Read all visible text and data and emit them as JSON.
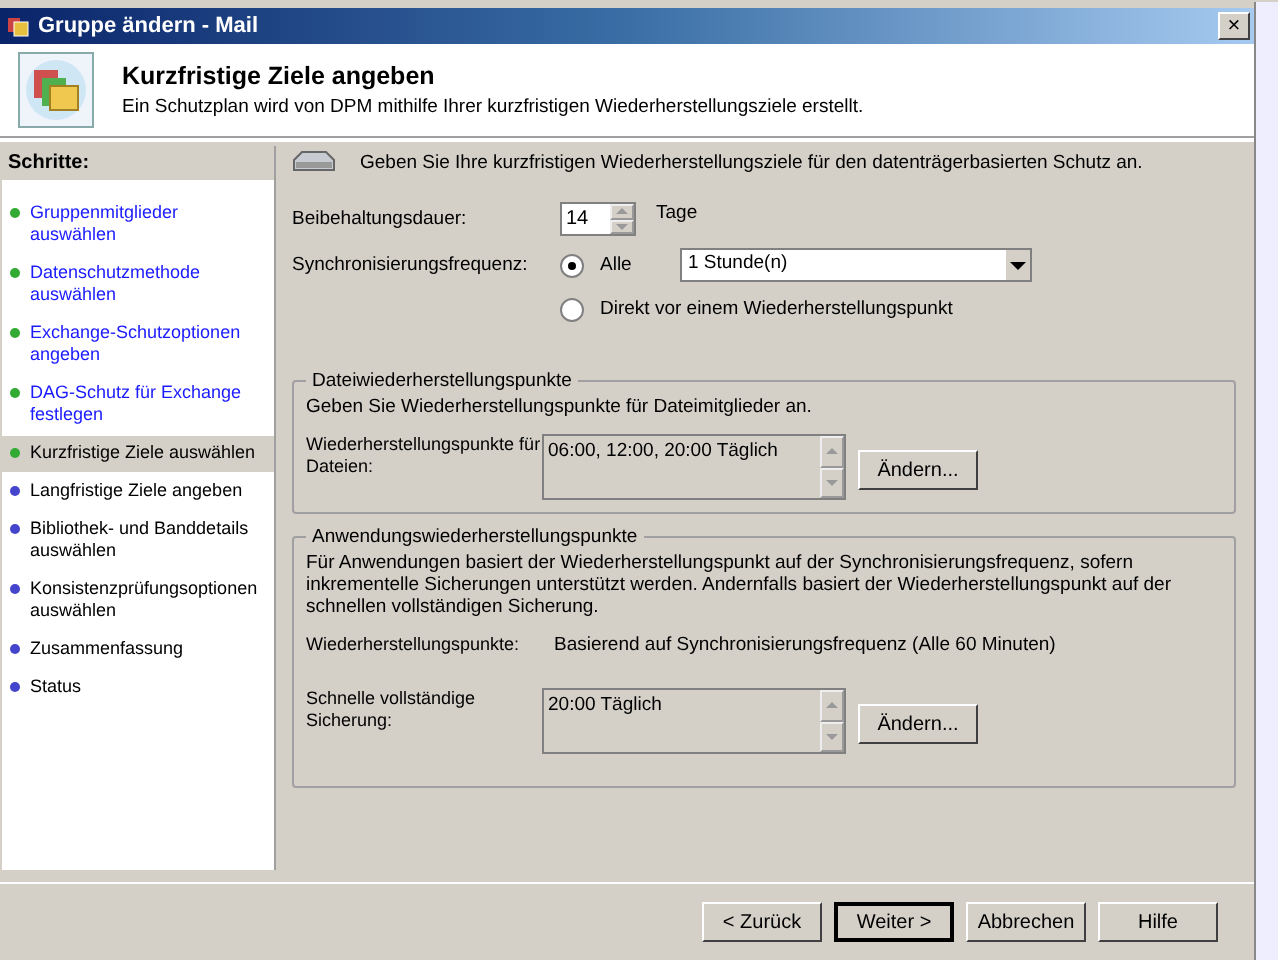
{
  "window": {
    "title": "Gruppe ändern - Mail",
    "close": "×"
  },
  "header": {
    "title": "Kurzfristige Ziele angeben",
    "subtitle": "Ein Schutzplan wird von DPM mithilfe Ihrer kurzfristigen Wiederherstellungsziele erstellt."
  },
  "sidebar": {
    "title": "Schritte:",
    "items": [
      {
        "label": "Gruppenmitglieder auswählen",
        "done": true,
        "selected": false
      },
      {
        "label": "Datenschutzmethode auswählen",
        "done": true,
        "selected": false
      },
      {
        "label": "Exchange-Schutzoptionen angeben",
        "done": true,
        "selected": false
      },
      {
        "label": "DAG-Schutz für Exchange festlegen",
        "done": true,
        "selected": false
      },
      {
        "label": "Kurzfristige Ziele auswählen",
        "done": true,
        "selected": true
      },
      {
        "label": "Langfristige Ziele angeben",
        "done": false,
        "selected": false
      },
      {
        "label": "Bibliothek- und Banddetails auswählen",
        "done": false,
        "selected": false
      },
      {
        "label": "Konsistenzprüfungsoptionen auswählen",
        "done": false,
        "selected": false
      },
      {
        "label": "Zusammenfassung",
        "done": false,
        "selected": false
      },
      {
        "label": "Status",
        "done": false,
        "selected": false
      }
    ]
  },
  "intro": "Geben Sie Ihre kurzfristigen Wiederherstellungsziele für den datenträgerbasierten Schutz an.",
  "retention": {
    "label": "Beibehaltungsdauer:",
    "value": "14",
    "unit": "Tage"
  },
  "sync": {
    "label": "Synchronisierungsfrequenz:",
    "options": [
      {
        "label": "Alle",
        "selected": true,
        "dropdown": "1 Stunde(n)"
      },
      {
        "label": "Direkt vor einem Wiederherstellungspunkt",
        "selected": false
      }
    ]
  },
  "file_points": {
    "title": "Dateiwiederherstellungspunkte",
    "description": "Geben Sie Wiederherstellungspunkte für Dateimitglieder an.",
    "label": "Wiederherstellungspunkte für Dateien:",
    "value": "06:00, 12:00, 20:00 Täglich",
    "button": "Ändern..."
  },
  "app_points": {
    "title": "Anwendungswiederherstellungspunkte",
    "description": "Für Anwendungen basiert der Wiederherstellungspunkt auf der Synchronisierungsfrequenz, sofern inkrementelle Sicherungen unterstützt werden. Andernfalls basiert der Wiederherstellungspunkt auf der schnellen vollständigen Sicherung.",
    "points_label": "Wiederherstellungspunkte:",
    "points_value": "Basierend auf Synchronisierungsfrequenz (Alle 60 Minuten)",
    "label": "Schnelle vollständige Sicherung:",
    "value": "20:00 Täglich",
    "button": "Ändern..."
  },
  "buttons": [
    {
      "label": "< Zurück",
      "default": false
    },
    {
      "label": "Weiter >",
      "default": true
    },
    {
      "label": "Abbrechen",
      "default": false
    },
    {
      "label": "Hilfe",
      "default": false
    }
  ]
}
